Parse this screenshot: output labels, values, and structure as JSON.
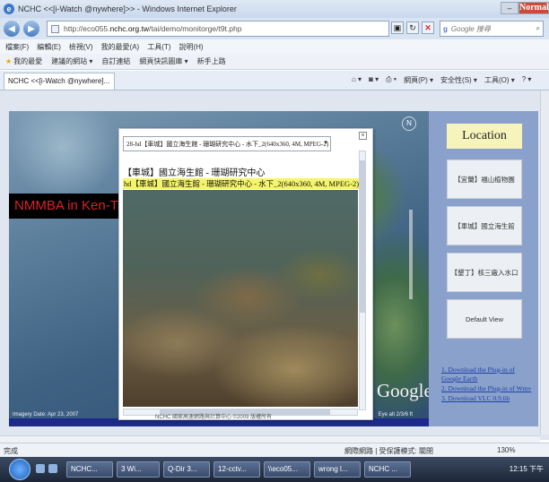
{
  "window": {
    "title": "NCHC <<[i-Watch @nywhere]>> - Windows Internet Explorer",
    "maximize_label": "Normal"
  },
  "address": {
    "url_prefix": "http://eco055.",
    "url_host": "nchc.org.tw",
    "url_path": "/tai/demo/monitorge/t9t.php",
    "search_placeholder": "Google 搜尋"
  },
  "menu": [
    "檔案(F)",
    "編輯(E)",
    "檢視(V)",
    "我的最愛(A)",
    "工具(T)",
    "說明(H)"
  ],
  "favorites": [
    "我的最愛",
    "建議的網站 ▾",
    "自訂連結",
    "網頁快訊圖庫 ▾",
    "新手上路"
  ],
  "tab": {
    "label": "NCHC <<[i-Watch @nywhere]..."
  },
  "tab_tools": [
    "網頁(P) ▾",
    "安全性(S) ▾",
    "工具(O) ▾"
  ],
  "map": {
    "imagery_date": "Imagery Date: Apr 23, 2007",
    "eye_alt": "Eye alt  2/3/6 ft",
    "logo": "Google",
    "banner": "NMMBA in Ken-Ting"
  },
  "popup": {
    "select_value": "28-hd【車城】國立海生館 - 珊瑚研究中心 - 水下_2(640x360, 4M, MPEG-2)",
    "title": "【車城】國立海生館 - 珊瑚研究中心",
    "subtitle": "hd【車城】國立海生館 - 珊瑚研究中心 - 水下_2(640x360, 4M, MPEG-2)",
    "footer": "NCHC 國家高速網路與計算中心 ©2009 版權所有"
  },
  "location": {
    "heading": "Location",
    "buttons": [
      "【宜蘭】福山植物園",
      "【車城】國立海生館",
      "【墾丁】核三廠入水口",
      "Default View"
    ],
    "links": [
      "1. Download the Plug-in of Google Earth",
      "2. Download the Plug-in of Wmv",
      "3. Download VLC 0.9.6b"
    ]
  },
  "status": {
    "done": "完成",
    "zone": "網際網路 | 受保護模式: 關閉",
    "zoom": "130%"
  },
  "taskbar": {
    "items": [
      "NCHC...",
      "3 Wi...",
      "Q-Dir 3...",
      "12-cctv...",
      "\\\\eco05...",
      "wrong l...",
      "NCHC ..."
    ],
    "time": "12:15 下午"
  },
  "colors": {
    "banner_text": "#d8212b",
    "panel_bg": "#8aa2cb",
    "location_bg": "#f6f4ba",
    "link": "#1f3fa8"
  }
}
